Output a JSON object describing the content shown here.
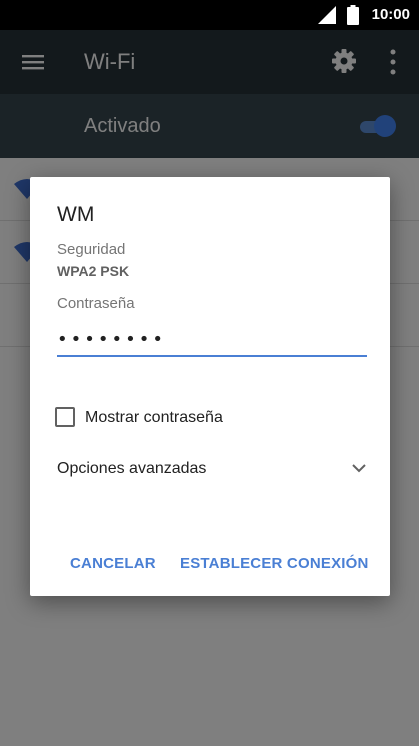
{
  "status_bar": {
    "time": "10:00",
    "icons": [
      "signal-icon",
      "battery-icon"
    ]
  },
  "toolbar": {
    "title": "Wi-Fi",
    "icons": [
      "menu-icon",
      "gear-icon",
      "more-vert-icon"
    ]
  },
  "wifi_switch": {
    "label": "Activado",
    "on": true
  },
  "networks": [
    {
      "icon": "wifi-signal-icon"
    },
    {
      "icon": "wifi-signal-icon"
    }
  ],
  "dialog": {
    "title": "WM",
    "security_label": "Seguridad",
    "security_value": "WPA2 PSK",
    "password_label": "Contraseña",
    "password_value": "••••••••",
    "show_password_label": "Mostrar contraseña",
    "show_password_checked": false,
    "advanced_label": "Opciones avanzadas",
    "cancel_label": "CANCELAR",
    "connect_label": "ESTABLECER CONEXIÓN"
  },
  "colors": {
    "toolbar": "#263238",
    "switchbar": "#37474f",
    "accent": "#4a7fd4",
    "toggle_thumb": "#4285f4"
  }
}
